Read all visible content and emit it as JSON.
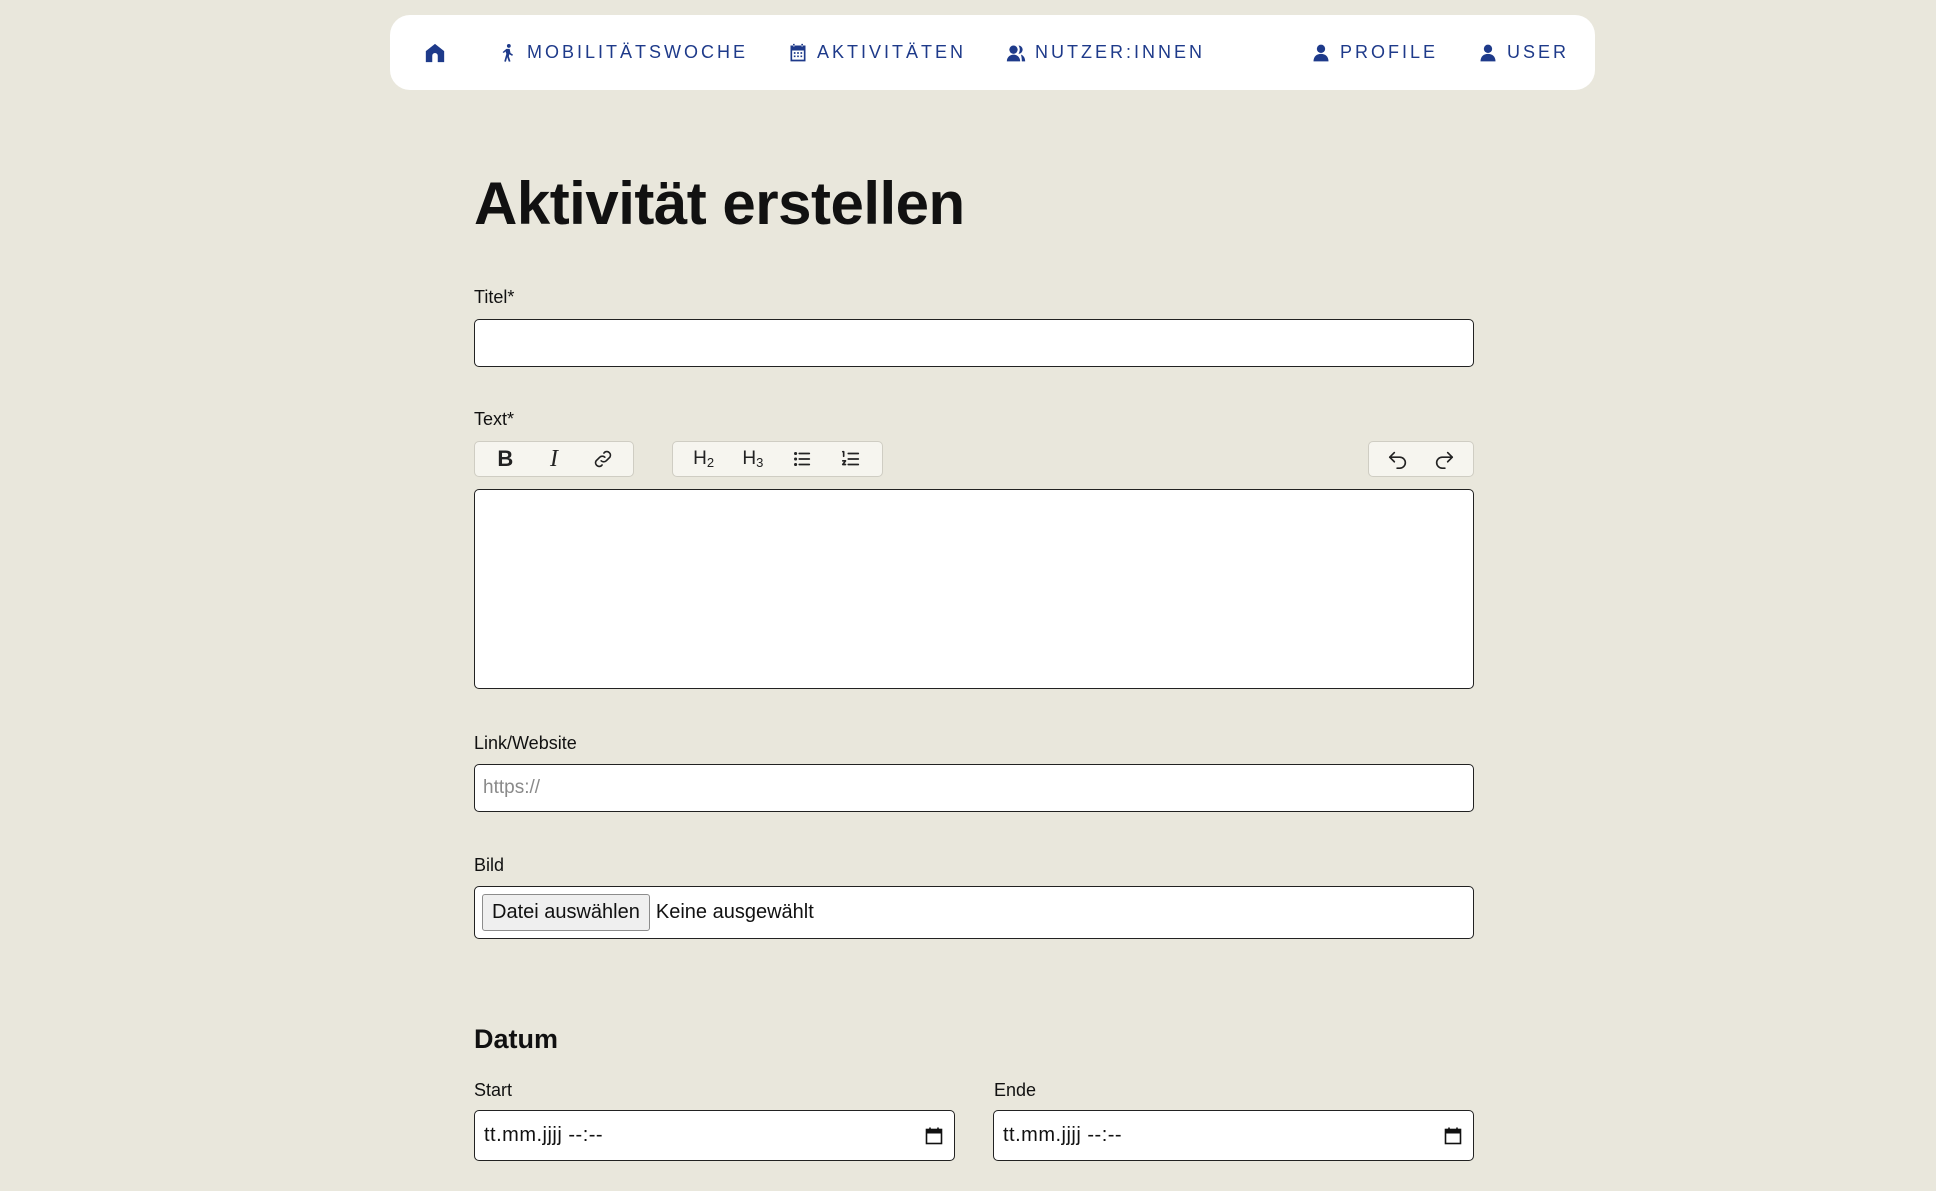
{
  "nav": {
    "left": [
      {
        "label": "",
        "icon": "home-icon"
      },
      {
        "label": "Mobilitätswoche",
        "icon": "walking-person-icon"
      },
      {
        "label": "Aktivitäten",
        "icon": "calendar-icon"
      },
      {
        "label": "Nutzer:innen",
        "icon": "users-icon"
      }
    ],
    "right": [
      {
        "label": "Profile",
        "icon": "user-icon"
      },
      {
        "label": "User",
        "icon": "user-icon"
      }
    ],
    "color": "#1e3a8a"
  },
  "page": {
    "title": "Aktivität erstellen"
  },
  "form": {
    "title_label": "Titel*",
    "title_value": "",
    "text_label": "Text*",
    "toolbar": {
      "bold": "B",
      "italic": "I",
      "h2": "H",
      "h2_sub": "2",
      "h3": "H",
      "h3_sub": "3",
      "icons": [
        "bold-icon",
        "italic-icon",
        "link-icon",
        "heading-2-icon",
        "heading-3-icon",
        "bullet-list-icon",
        "numbered-list-icon",
        "undo-icon",
        "redo-icon"
      ]
    },
    "link_label": "Link/Website",
    "link_placeholder": "https://",
    "image_label": "Bild",
    "file_button": "Datei auswählen",
    "file_status": "Keine ausgewählt",
    "date_section": "Datum",
    "start_label": "Start",
    "start_mask": "tt.mm.jjjj --:--",
    "end_label": "Ende",
    "end_mask": "tt.mm.jjjj --:--"
  },
  "colors": {
    "background": "#e9e7dc",
    "nav_bg": "#ffffff",
    "accent": "#1e3a8a"
  }
}
